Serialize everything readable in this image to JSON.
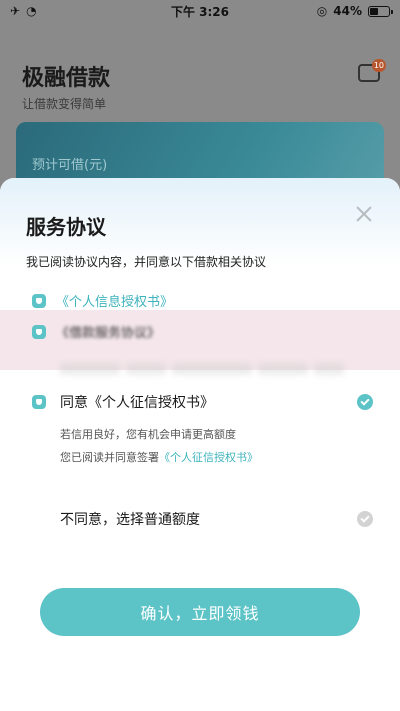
{
  "status_bar": {
    "time": "下午 3:26",
    "battery": "44%"
  },
  "background": {
    "app_title": "极融借款",
    "app_subtitle": "让借款变得简单",
    "message_badge": "10",
    "card_label": "预计可借(元)"
  },
  "sheet": {
    "title": "服务协议",
    "description": "我已阅读协议内容，并同意以下借款相关协议",
    "agreements": [
      {
        "label": "《个人信息授权书》",
        "icon": "shield-icon"
      },
      {
        "label": "《借款服务协议》",
        "icon": "shield-icon"
      }
    ],
    "option_agree": {
      "title": "同意《个人征信授权书》",
      "note1": "若信用良好，您有机会申请更高额度",
      "note2_prefix": "您已阅读并同意签署",
      "note2_link": "《个人征信授权书》"
    },
    "option_disagree": {
      "title": "不同意，选择普通额度"
    },
    "confirm_button": "确认，立即领钱"
  },
  "colors": {
    "accent": "#5cc3c7",
    "link": "#3db3bc"
  }
}
